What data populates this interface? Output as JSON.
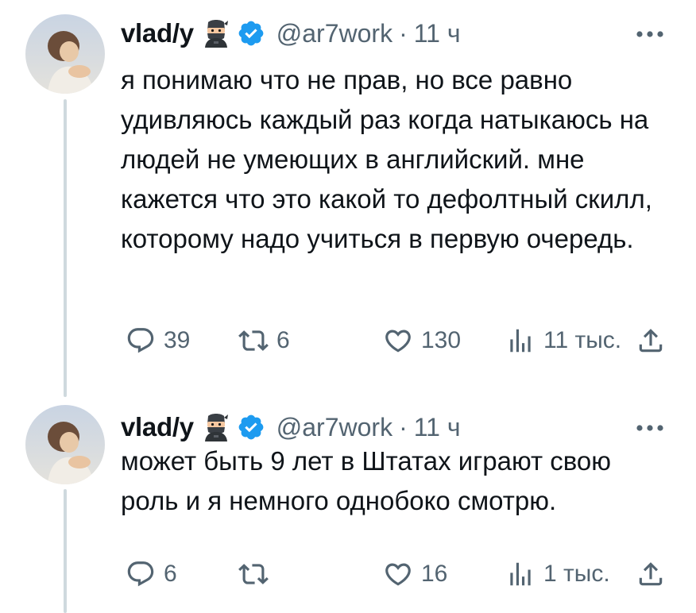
{
  "tweets": [
    {
      "author": {
        "display_name": "vlad/y",
        "badge_emoji": "ninja-icon",
        "verified": true,
        "handle": "@ar7work"
      },
      "separator": "·",
      "time": "11 ч",
      "text": "я понимаю что не прав, но все равно удивляюсь каждый раз когда натыкаюсь на людей не умеющих в английский. мне кажется что это какой то дефолтный скилл, которому надо учиться в первую очередь.",
      "stats": {
        "replies": "39",
        "retweets": "6",
        "likes": "130",
        "views": "11 тыс."
      }
    },
    {
      "author": {
        "display_name": "vlad/y",
        "badge_emoji": "ninja-icon",
        "verified": true,
        "handle": "@ar7work"
      },
      "separator": "·",
      "time": "11 ч",
      "text": "может быть 9 лет в Штатах играют свою роль и я немного однобоко смотрю.",
      "stats": {
        "replies": "6",
        "retweets": "",
        "likes": "16",
        "views": "1 тыс."
      }
    }
  ],
  "colors": {
    "text": "#0f1419",
    "secondary": "#536471",
    "verified": "#1d9bf0",
    "thread_line": "#cfd9de"
  }
}
